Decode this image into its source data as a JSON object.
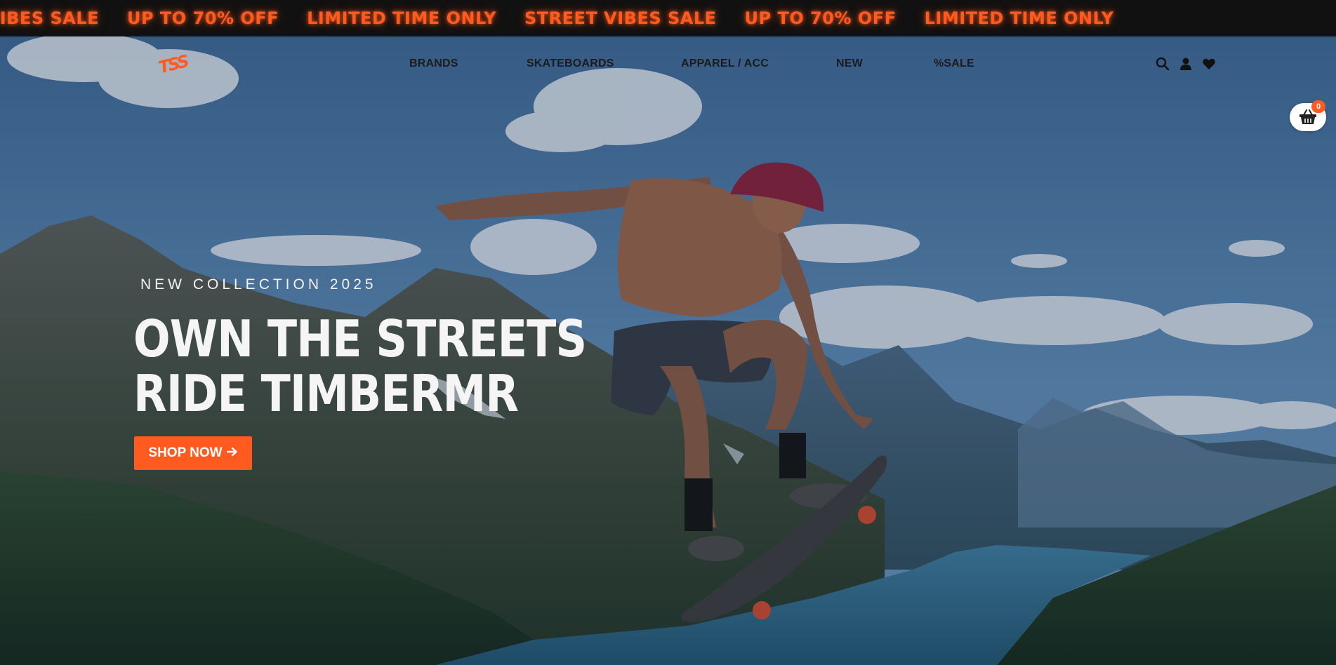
{
  "marquee": {
    "items": [
      "ET VIBES SALE",
      "UP TO 70% OFF",
      "LIMITED TIME ONLY",
      "STREET VIBES SALE",
      "UP TO 70% OFF",
      "LIMITED TIME ONLY"
    ]
  },
  "header": {
    "logo": "TSS",
    "nav": [
      "BRANDS",
      "SKATEBOARDS",
      "APPAREL / ACC",
      "NEW",
      "%SALE"
    ],
    "icons": [
      "search-icon",
      "user-icon",
      "heart-icon"
    ],
    "cart": {
      "icon": "basket-icon",
      "count": "0"
    }
  },
  "hero": {
    "eyebrow": "NEW COLLECTION 2025",
    "headline_line1": "OWN THE STREETS",
    "headline_line2": "RIDE TIMBERMR",
    "cta_label": "SHOP NOW",
    "cta_icon": "arrow-right-icon"
  },
  "colors": {
    "accent": "#ff5a1f",
    "marquee_bg": "#111111",
    "nav_text": "#1b1b1b"
  }
}
